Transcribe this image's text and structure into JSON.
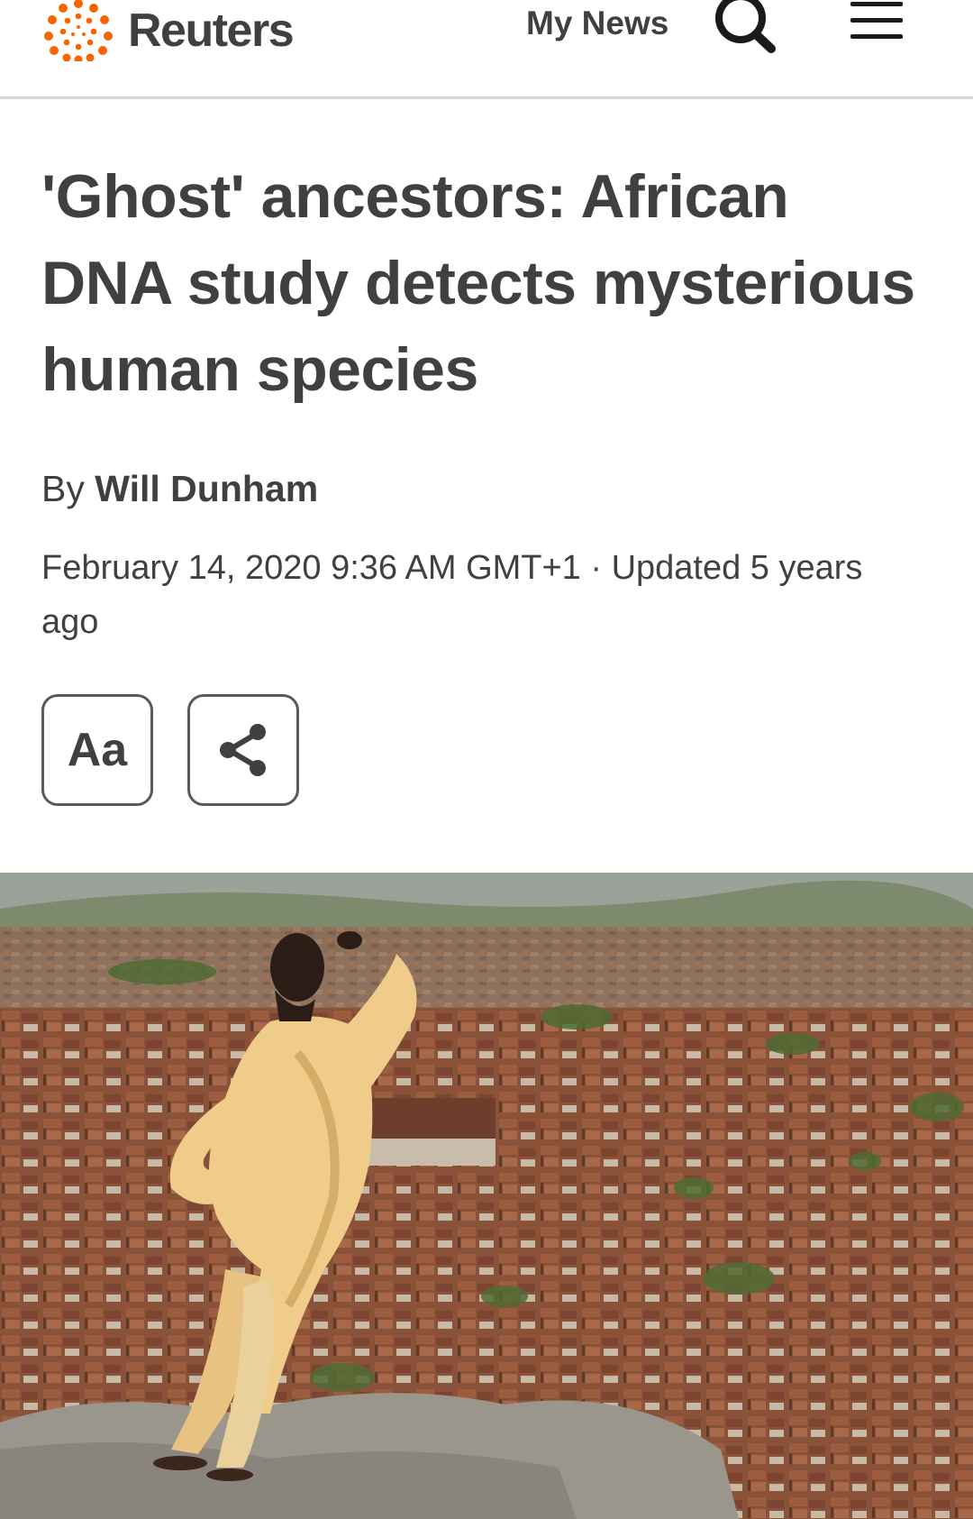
{
  "header": {
    "brand": "Reuters",
    "my_news_label": "My News",
    "search_icon": "search-icon",
    "menu_icon": "hamburger-menu-icon",
    "brand_color": "#fa6400"
  },
  "article": {
    "headline": "'Ghost' ancestors: African DNA study detects mysterious human species",
    "byline_prefix": "By",
    "author": "Will Dunham",
    "dateline": "February 14, 2020 9:36 AM GMT+1 · Updated 5 years ago"
  },
  "actions": {
    "text_size_label": "Aa",
    "share_icon": "share-icon"
  },
  "hero_image": {
    "description_icon": "photo"
  }
}
